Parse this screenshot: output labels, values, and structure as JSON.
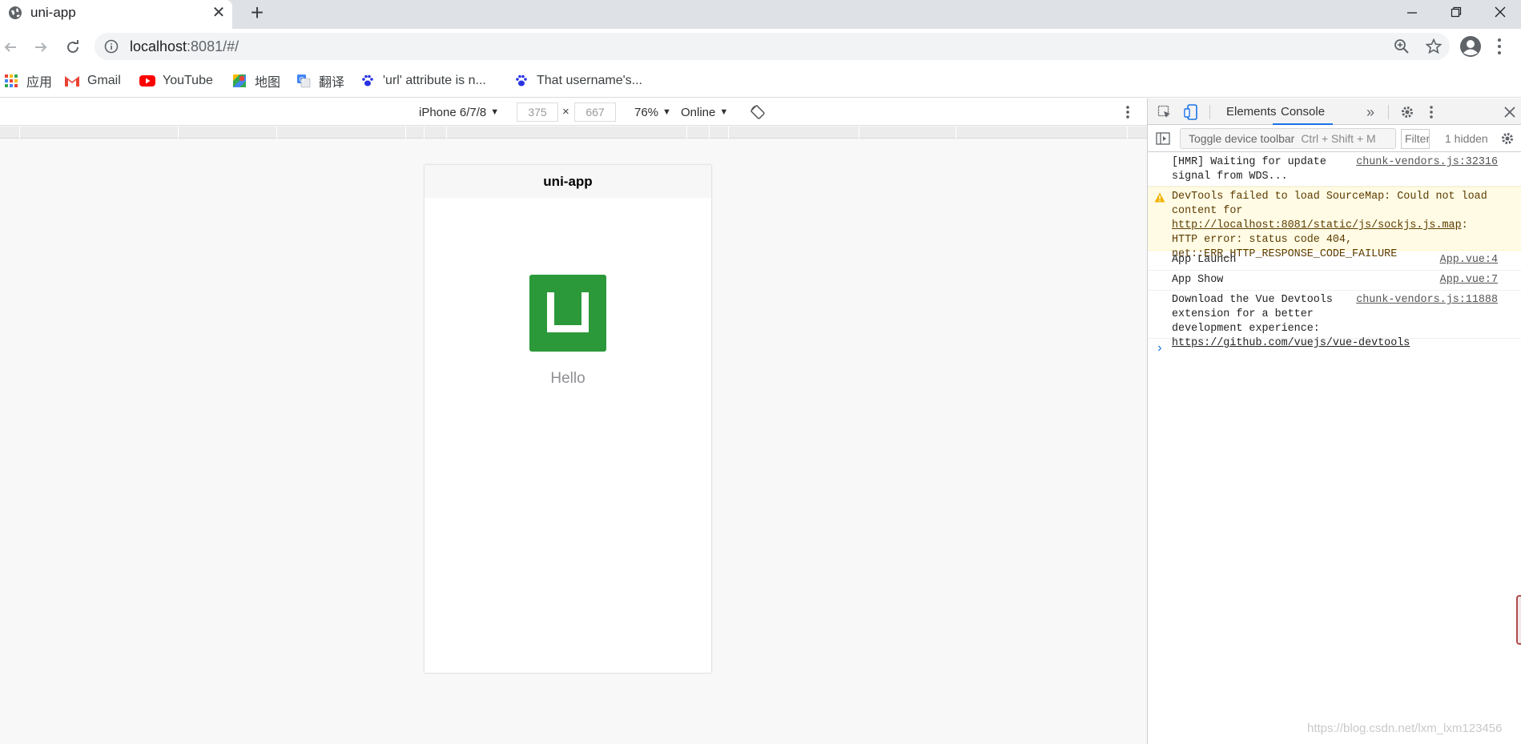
{
  "browser": {
    "tab_title": "uni-app",
    "url_host": "localhost",
    "url_rest": ":8081/#/",
    "bookmarks": [
      {
        "label": "应用",
        "icon": "apps-grid-icon"
      },
      {
        "label": "Gmail",
        "icon": "gmail-icon"
      },
      {
        "label": "YouTube",
        "icon": "youtube-icon"
      },
      {
        "label": "地图",
        "icon": "maps-icon"
      },
      {
        "label": "翻译",
        "icon": "translate-icon"
      },
      {
        "label": "'url' attribute is n...",
        "icon": "paw-icon"
      },
      {
        "label": "That username's...",
        "icon": "paw-icon"
      }
    ]
  },
  "device_toolbar": {
    "device": "iPhone 6/7/8",
    "width": "375",
    "height": "667",
    "times": "×",
    "zoom": "76%",
    "network": "Online"
  },
  "app": {
    "nav_title": "uni-app",
    "hello": "Hello",
    "logo_color": "#2b9939"
  },
  "devtools": {
    "tabs": [
      "Elements",
      "Console"
    ],
    "active_tab": "Console",
    "tooltip_text": "Toggle device toolbar",
    "tooltip_shortcut": "Ctrl + Shift + M",
    "filter_placeholder": "Filter",
    "hidden": "1 hidden",
    "messages": [
      {
        "text": "[HMR] Waiting for update signal from WDS...",
        "source": "chunk-vendors.js:32316",
        "level": "log"
      },
      {
        "text_pre": "DevTools failed to load SourceMap: Could not load content for ",
        "link": "http://localhost:8081/static/js/sockjs.js.map",
        "text_post": ": HTTP error: status code 404, net::ERR_HTTP_RESPONSE_CODE_FAILURE",
        "level": "warning"
      },
      {
        "text": "App Launch",
        "source": "App.vue:4",
        "level": "log"
      },
      {
        "text": "App Show",
        "source": "App.vue:7",
        "level": "log"
      },
      {
        "text": "Download the Vue Devtools extension for a better development experience:",
        "link": "https://github.com/vuejs/vue-devtools",
        "source": "chunk-vendors.js:11888",
        "level": "log"
      }
    ],
    "prompt": "›"
  },
  "watermark": "https://blog.csdn.net/lxm_lxm123456",
  "colors": {
    "accent": "#1a73e8",
    "tabstrip": "#dee1e6",
    "warning_bg": "#fffbe5"
  }
}
